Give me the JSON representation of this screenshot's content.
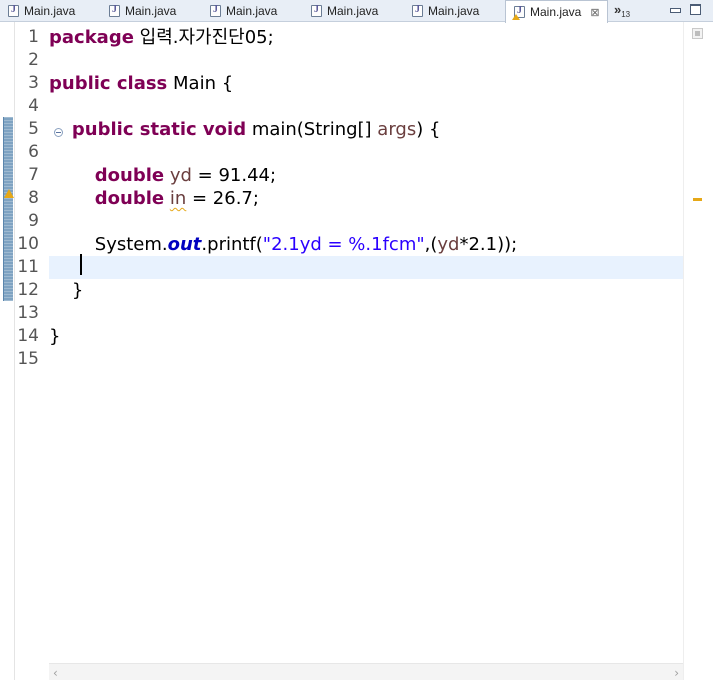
{
  "tabs": [
    {
      "label": "Main.java",
      "active": false,
      "warning": false
    },
    {
      "label": "Main.java",
      "active": false,
      "warning": false
    },
    {
      "label": "Main.java",
      "active": false,
      "warning": false
    },
    {
      "label": "Main.java",
      "active": false,
      "warning": false
    },
    {
      "label": "Main.java",
      "active": false,
      "warning": false
    },
    {
      "label": "Main.java",
      "active": true,
      "warning": true
    }
  ],
  "tab_close_glyph": "⊠",
  "overflow": {
    "glyph": "»",
    "count": "13"
  },
  "editor": {
    "line_numbers": [
      "1",
      "2",
      "3",
      "4",
      "5",
      "6",
      "7",
      "8",
      "9",
      "10",
      "11",
      "12",
      "13",
      "14",
      "15"
    ],
    "current_line": 11,
    "lines": {
      "l1": {
        "kw": "package",
        "rest": " 입력.자가진단05;"
      },
      "l3": {
        "kw": "public class",
        "rest": " Main {"
      },
      "l5": {
        "indent": "    ",
        "kw": "public static void",
        "rest_a": " main(String[] ",
        "var": "args",
        "rest_b": ") {"
      },
      "l7": {
        "indent": "        ",
        "kw": "double",
        "sp": " ",
        "var": "yd",
        "rest": " = 91.44;"
      },
      "l8": {
        "indent": "        ",
        "kw": "double",
        "sp": " ",
        "var": "in",
        "rest": " = 26.7;"
      },
      "l10": {
        "indent": "        ",
        "cls": "System.",
        "field": "out",
        "call": ".printf(",
        "str": "\"2.1yd = %.1fcm\"",
        "comma": ",(",
        "var": "yd",
        "rest": "*2.1));"
      },
      "l12": {
        "text": "    }"
      },
      "l14": {
        "text": "}"
      }
    }
  },
  "colors": {
    "keyword": "#7f0055",
    "string": "#2a00ff",
    "field": "#0000c0",
    "local_variable": "#6a3e3e",
    "current_line": "#e8f2fe",
    "warning": "#e6a817"
  },
  "icons": {
    "tab_file": "java-file-icon",
    "warning": "warning-icon",
    "fold": "collapse-icon",
    "minimize": "minimize-icon",
    "maximize": "maximize-icon"
  },
  "scrollbar": {
    "left_glyph": "‹",
    "right_glyph": "›"
  }
}
